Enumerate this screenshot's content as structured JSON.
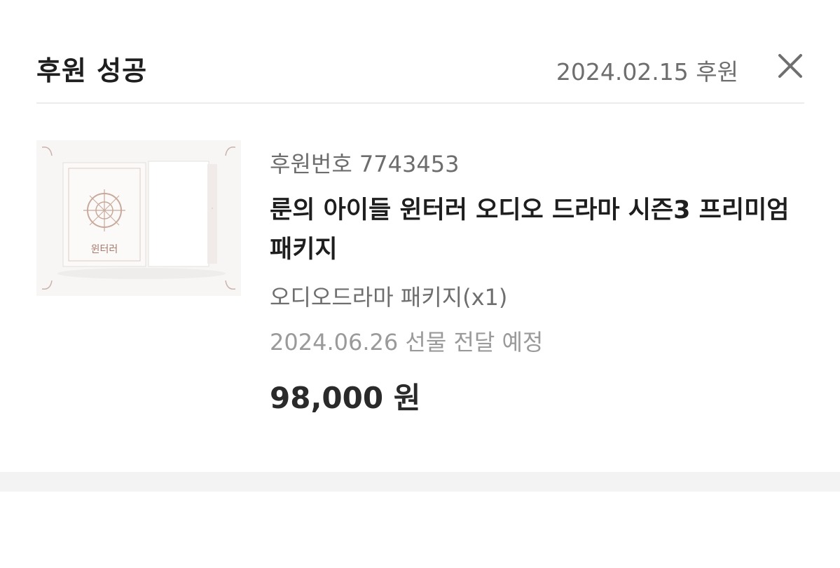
{
  "header": {
    "title": "후원 성공",
    "date_label": "2024.02.15 후원",
    "close_icon": "close-icon"
  },
  "product": {
    "thumbnail_icon": "product-thumbnail",
    "thumbnail_title": "윈터러",
    "order_number": "후원번호 7743453",
    "name": "룬의 아이들 윈터러 오디오 드라마 시즌3 프리미엄 패키지",
    "option": "오디오드라마 패키지(x1)",
    "delivery": "2024.06.26 선물 전달 예정",
    "price": "98,000 원"
  },
  "colors": {
    "title": "#1e1e1e",
    "muted": "#6e6e6e",
    "light": "#9a9a9a",
    "divider": "#ececec",
    "band": "#f3f3f3"
  }
}
